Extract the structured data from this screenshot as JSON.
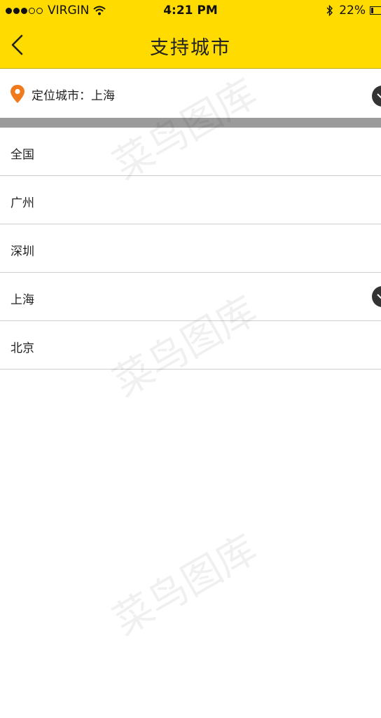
{
  "status_bar": {
    "carrier": "VIRGIN",
    "time": "4:21 PM",
    "battery": "22%",
    "icons": [
      "signal-dots-icon",
      "wifi-icon",
      "bluetooth-icon",
      "battery-icon"
    ]
  },
  "nav": {
    "title": "支持城市",
    "back_icon": "chevron-left-icon"
  },
  "location": {
    "label": "定位城市：",
    "city": "上海",
    "icon": "location-pin-icon",
    "selected": true
  },
  "cities": [
    {
      "name": "全国",
      "selected": false
    },
    {
      "name": "广州",
      "selected": false
    },
    {
      "name": "深圳",
      "selected": false
    },
    {
      "name": "上海",
      "selected": true
    },
    {
      "name": "北京",
      "selected": false
    }
  ],
  "watermark": "菜鸟图库",
  "colors": {
    "header": "#ffdb00",
    "pin": "#f07b1e",
    "check": "#333333",
    "divider_band": "#9b9b9b"
  }
}
